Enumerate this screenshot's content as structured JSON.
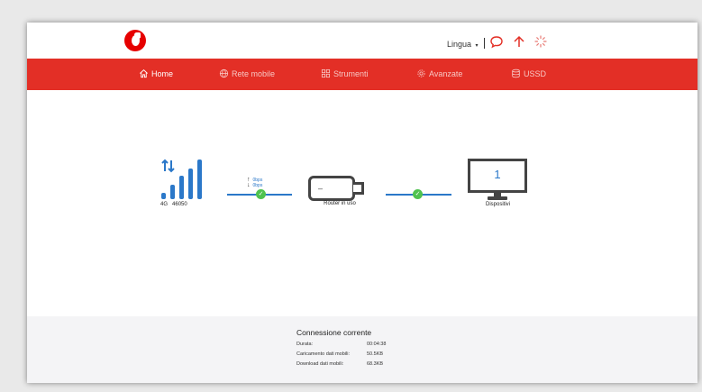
{
  "header": {
    "language_label": "Lingua",
    "language_caret": "▾"
  },
  "nav": {
    "items": [
      {
        "label": "Home",
        "icon": "home-icon"
      },
      {
        "label": "Rete mobile",
        "icon": "globe-icon"
      },
      {
        "label": "Strumenti",
        "icon": "tools-grid-icon"
      },
      {
        "label": "Avanzate",
        "icon": "gear-icon"
      },
      {
        "label": "USSD",
        "icon": "database-icon"
      }
    ],
    "active": "Home"
  },
  "status": {
    "network_type": "4G",
    "operator": "46050",
    "upload_speed": "0bps",
    "download_speed": "0bps",
    "router_label": "Router in uso",
    "router_screen": "–",
    "devices_count": "1",
    "devices_label": "Dispositivi"
  },
  "connection": {
    "title": "Connessione corrente",
    "rows": [
      {
        "label": "Durata:",
        "value": "00:04:38"
      },
      {
        "label": "Caricamento dati mobili:",
        "value": "50.5KB"
      },
      {
        "label": "Download dati mobili:",
        "value": "68.3KB"
      }
    ]
  },
  "colors": {
    "brand_red": "#e32f26",
    "accent_blue": "#2b78c9",
    "ok_green": "#4fc24f"
  }
}
